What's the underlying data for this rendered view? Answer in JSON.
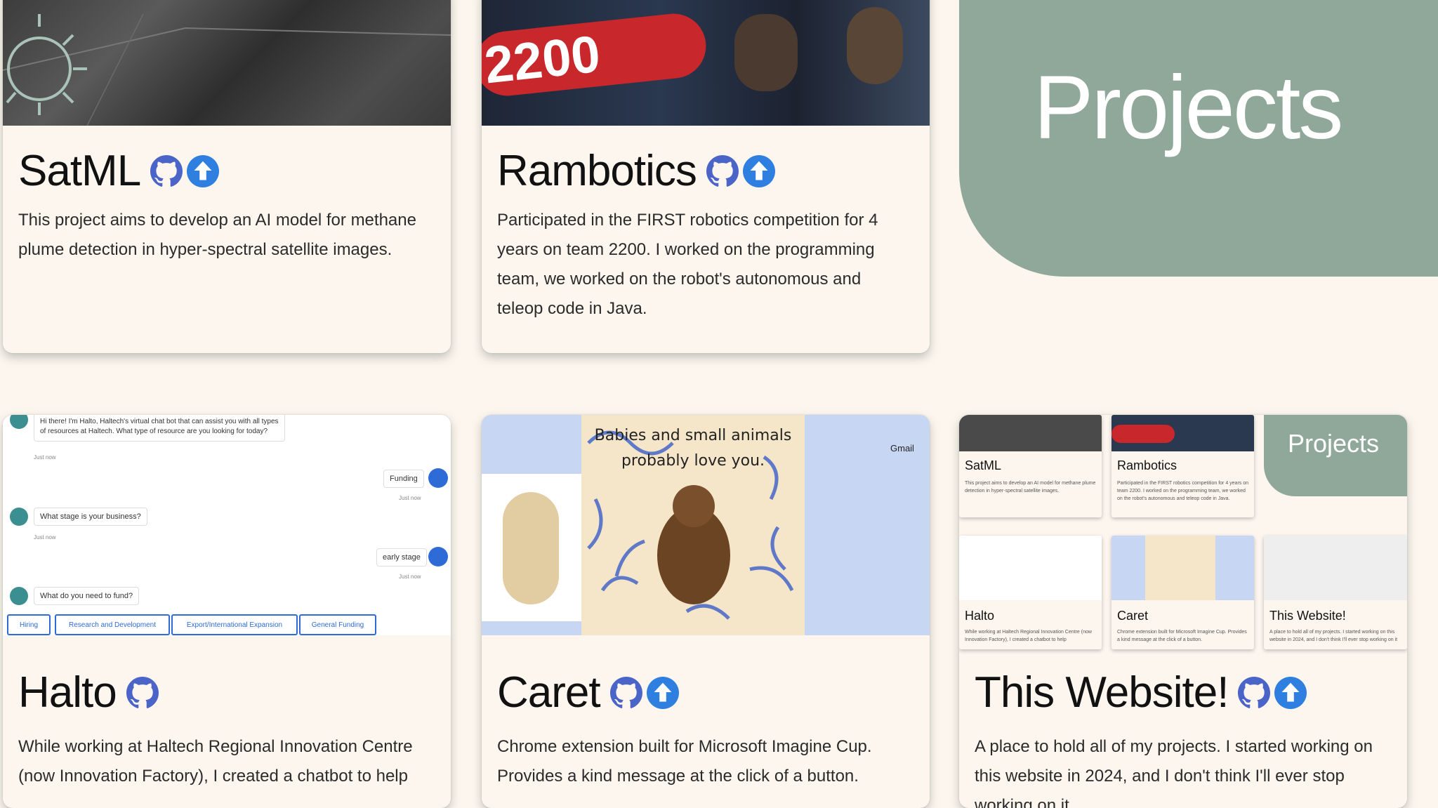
{
  "page": {
    "heading": "Projects"
  },
  "colors": {
    "accent": "#8fa89a",
    "background": "#fdf6ef",
    "icon_blue": "#4a64c8"
  },
  "cards": [
    {
      "title": "SatML",
      "links": [
        "github-icon",
        "upload-icon"
      ],
      "description": "This project aims to develop an AI model for methane plume detection in hyper-spectral satellite images."
    },
    {
      "title": "Rambotics",
      "links": [
        "github-icon",
        "upload-icon"
      ],
      "thumb_text": "2200",
      "description": "Participated in the FIRST robotics competition for 4 years on team 2200. I worked on the programming team, we worked on the robot's autonomous and teleop code in Java."
    },
    {
      "title": "Halto",
      "links": [
        "github-icon"
      ],
      "description": "While working at Haltech Regional Innovation Centre (now Innovation Factory), I created a chatbot to help"
    },
    {
      "title": "Caret",
      "links": [
        "github-icon",
        "upload-icon"
      ],
      "description": "Chrome extension built for Microsoft Imagine Cup. Provides a kind message at the click of a button."
    },
    {
      "title": "This Website!",
      "links": [
        "github-icon",
        "upload-icon"
      ],
      "description": "A place to hold all of my projects. I started working on this website in 2024, and I don't think I'll ever stop working on it"
    }
  ],
  "halto_chat": {
    "greeting": "Hi there! I'm Halto, Haltech's virtual chat bot that can assist you with all types of resources at Haltech. What type of resource are you looking for today?",
    "ts": "Just now",
    "user1": "Funding",
    "bot2": "What stage is your business?",
    "user2": "early stage",
    "bot3": "What do you need to fund?",
    "chips": [
      "Hiring",
      "Research and Development",
      "Export/International Expansion",
      "General Funding"
    ]
  },
  "caret_preview": {
    "message": "Babies and small animals probably love you.",
    "gmail": "Gmail"
  },
  "mini_preview": {
    "heading": "Projects",
    "cards": [
      "SatML",
      "Rambotics",
      "Halto",
      "Caret",
      "This Website!"
    ],
    "satml_desc": "This project aims to develop an AI model for methane plume detection in hyper-spectral satellite images.",
    "rambotics_desc": "Participated in the FIRST robotics competition for 4 years on team 2200. I worked on the programming team, we worked on the robot's autonomous and teleop code in Java.",
    "halto_desc": "While working at Haltech Regional Innovation Centre (now Innovation Factory), I created a chatbot to help",
    "caret_desc": "Chrome extension built for Microsoft Imagine Cup. Provides a kind message at the click of a button.",
    "website_desc": "A place to hold all of my projects. I started working on this website in 2024, and I don't think I'll ever stop working on it"
  }
}
